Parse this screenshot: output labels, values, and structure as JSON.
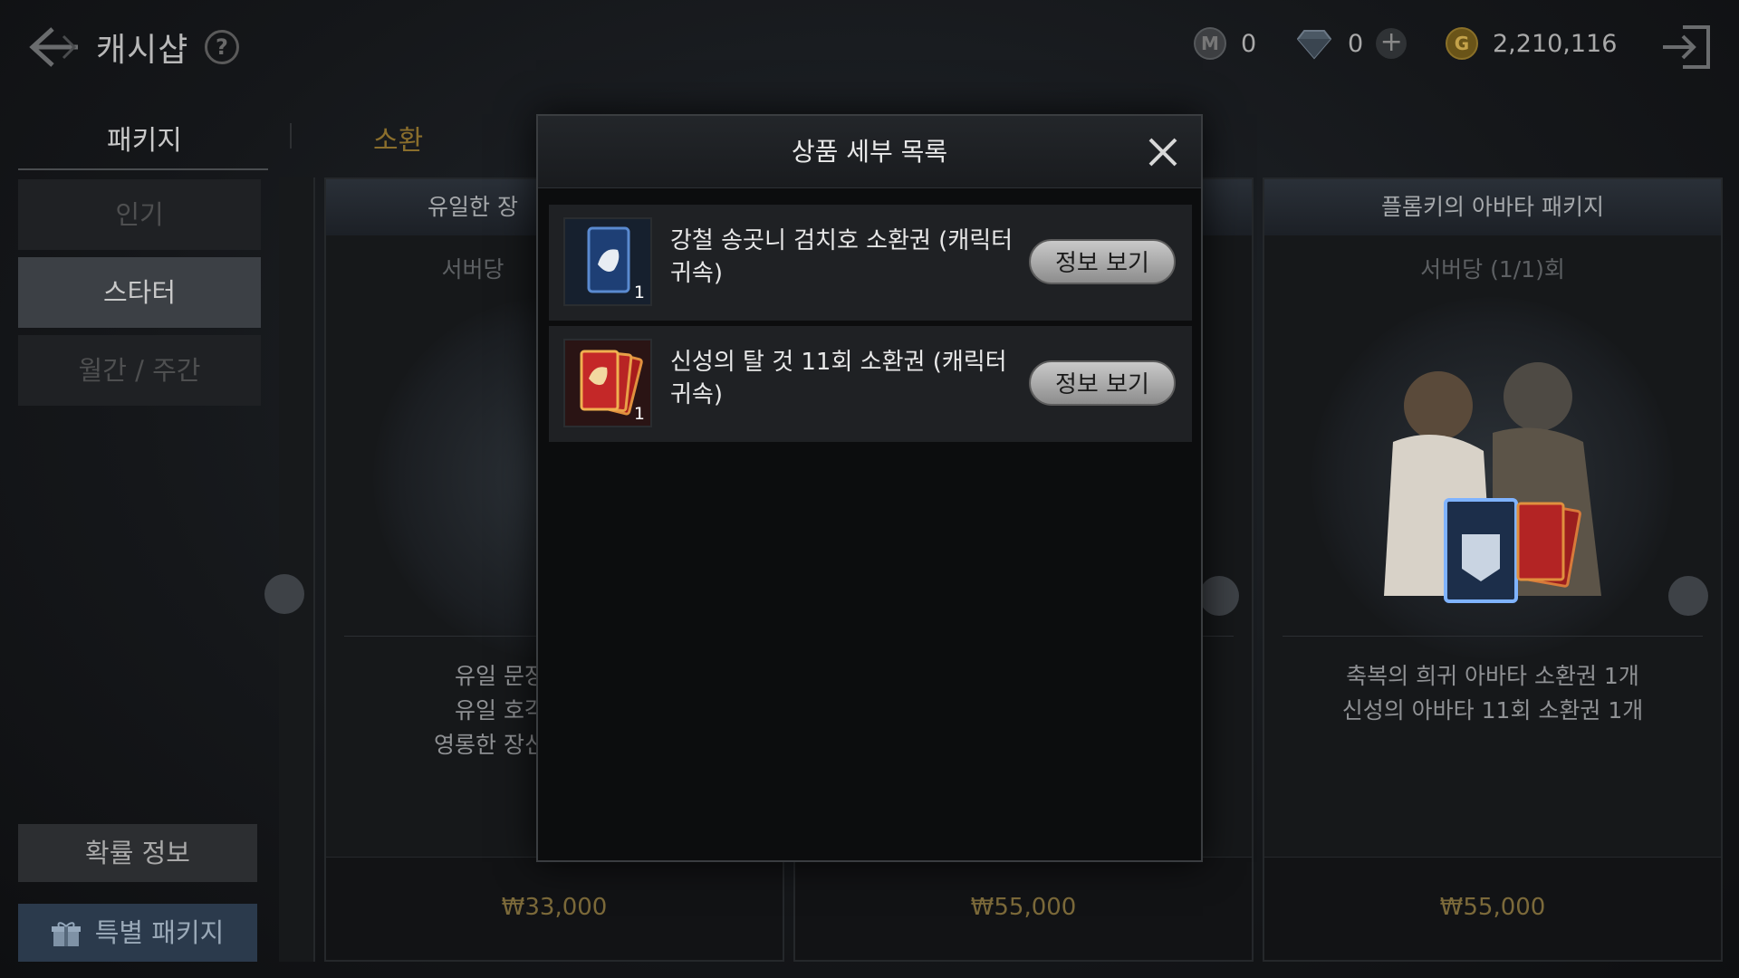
{
  "header": {
    "title": "캐시샵",
    "help_icon": "question-circle-icon",
    "currencies": {
      "mileage": "0",
      "diamond": "0",
      "gold": "2,210,116"
    }
  },
  "tabs": [
    {
      "label": "패키지",
      "state": "active"
    },
    {
      "label": "소환",
      "state": "highlight"
    }
  ],
  "sidebar": {
    "items": [
      {
        "label": "인기"
      },
      {
        "label": "스타터"
      },
      {
        "label": "월간 / 주간"
      }
    ],
    "active_index": 1,
    "probability_button": "확률 정보",
    "special_package_button": "특별 패키지"
  },
  "cards": [
    {
      "title_partial": "유일한 장",
      "limit_partial": "서버당",
      "desc_partial": [
        "유일 문장",
        "유일 호각",
        "영롱한 장신구"
      ],
      "price": "₩33,000"
    },
    {
      "price": "₩55,000"
    },
    {
      "title": "플롬키의 아바타 패키지",
      "limit": "서버당 (1/1)회",
      "desc": [
        "축복의 희귀 아바타 소환권 1개",
        "신성의 아바타 11회 소환권 1개"
      ],
      "price": "₩55,000"
    }
  ],
  "modal": {
    "title": "상품 세부 목록",
    "items": [
      {
        "name": "강철 송곳니 검치호 소환권 (캐릭터 귀속)",
        "qty": "1",
        "button": "정보 보기"
      },
      {
        "name": "신성의 탈 것 11회 소환권 (캐릭터 귀속)",
        "qty": "1",
        "button": "정보 보기"
      }
    ]
  },
  "colors": {
    "gold_text": "#7c6a3a",
    "accent_tab": "#8a6e2c",
    "button_silver": "#c9c9c9"
  }
}
